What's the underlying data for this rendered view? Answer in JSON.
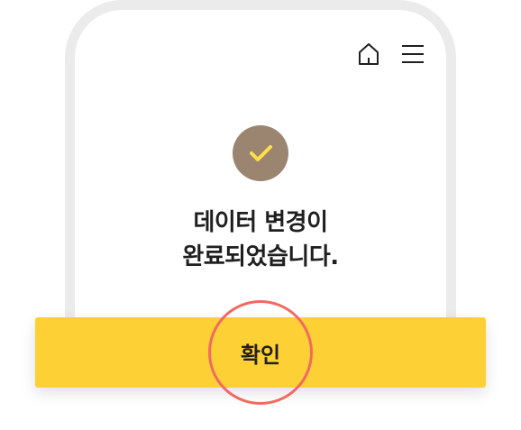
{
  "header": {
    "home_icon": "home-icon",
    "menu_icon": "hamburger-menu-icon"
  },
  "status": {
    "icon": "checkmark-icon",
    "badge_color": "#9b8571",
    "check_color": "#fde047"
  },
  "message": {
    "line1": "데이터 변경이",
    "line2": "완료되었습니다."
  },
  "confirm_button": {
    "label": "확인",
    "color": "#fdd135"
  },
  "highlight": {
    "color": "#f26a5f"
  }
}
